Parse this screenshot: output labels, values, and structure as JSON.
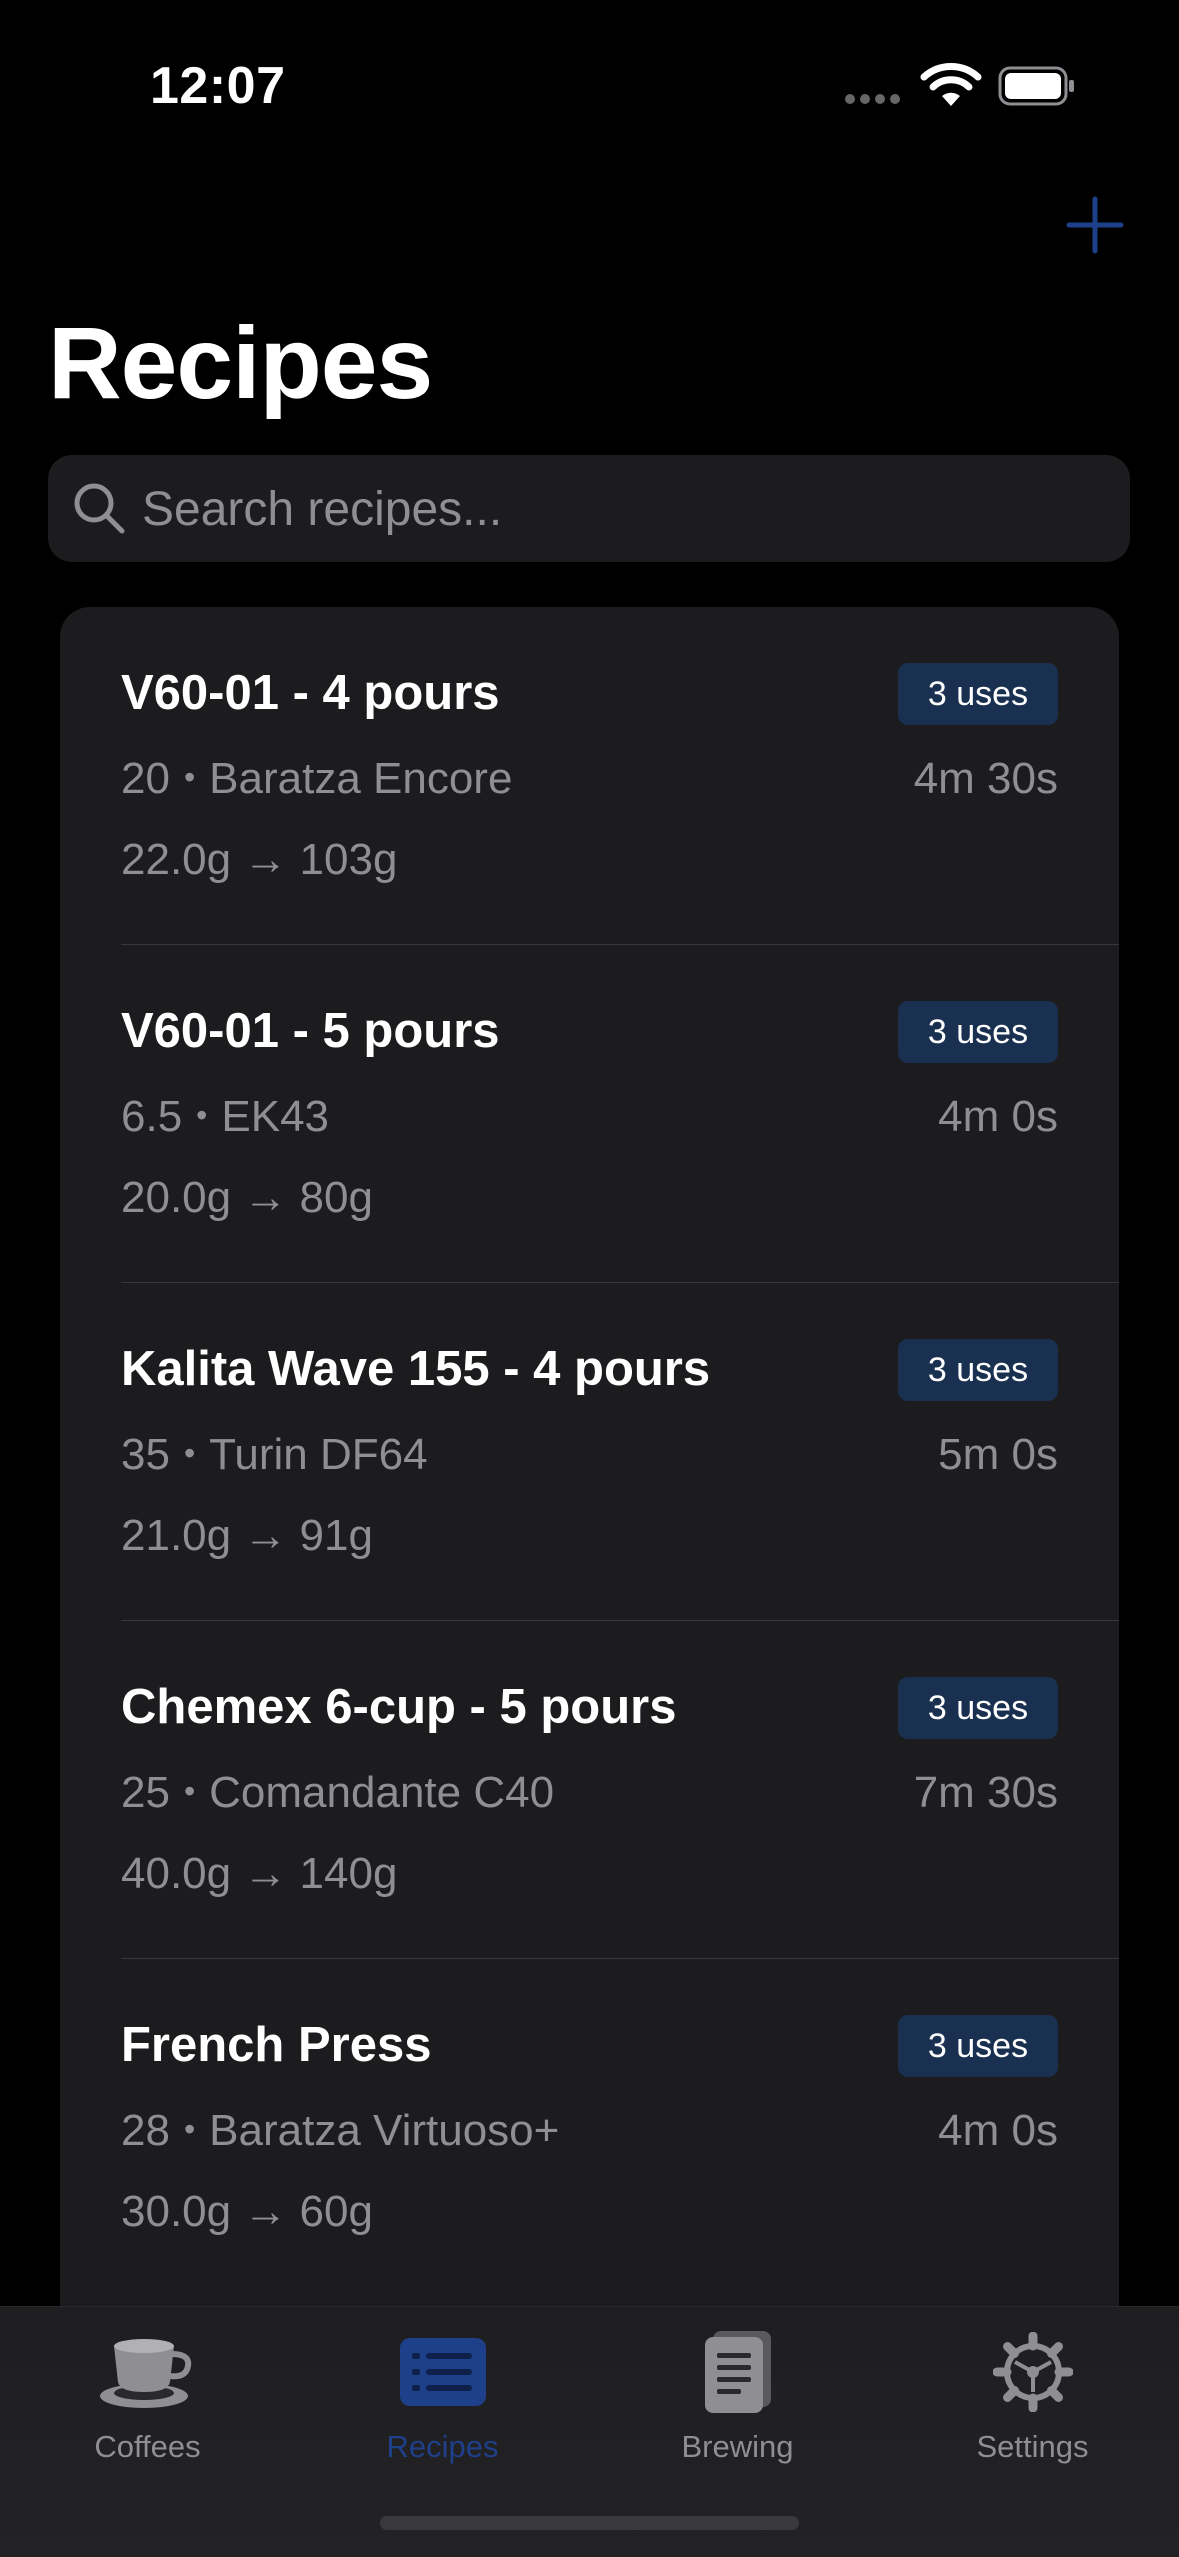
{
  "status_bar": {
    "time": "12:07"
  },
  "header": {
    "title": "Recipes",
    "add_label": "+"
  },
  "search": {
    "placeholder": "Search recipes..."
  },
  "recipes": [
    {
      "name": "V60-01 - 4 pours",
      "uses": "3 uses",
      "grind": "20",
      "grinder": "Baratza Encore",
      "separator": "•",
      "duration": "4m 30s",
      "ratio": "22.0g → 103g"
    },
    {
      "name": "V60-01 - 5 pours",
      "uses": "3 uses",
      "grind": "6.5",
      "grinder": "EK43",
      "separator": "•",
      "duration": "4m 0s",
      "ratio": "20.0g → 80g"
    },
    {
      "name": "Kalita Wave 155 - 4 pours",
      "uses": "3 uses",
      "grind": "35",
      "grinder": "Turin DF64",
      "separator": "•",
      "duration": "5m 0s",
      "ratio": "21.0g → 91g"
    },
    {
      "name": "Chemex 6-cup - 5 pours",
      "uses": "3 uses",
      "grind": "25",
      "grinder": "Comandante C40",
      "separator": "•",
      "duration": "7m 30s",
      "ratio": "40.0g → 140g"
    },
    {
      "name": "French Press",
      "uses": "3 uses",
      "grind": "28",
      "grinder": "Baratza Virtuoso+",
      "separator": "•",
      "duration": "4m 0s",
      "ratio": "30.0g → 60g"
    }
  ],
  "tab_bar": {
    "tabs": [
      {
        "label": "Coffees",
        "icon": "coffee-cup-icon",
        "active": false
      },
      {
        "label": "Recipes",
        "icon": "list-icon",
        "active": true
      },
      {
        "label": "Brewing",
        "icon": "notebook-icon",
        "active": false
      },
      {
        "label": "Settings",
        "icon": "gear-icon",
        "active": false
      }
    ]
  },
  "colors": {
    "background": "#000000",
    "surface": "#1c1c1e",
    "accent": "#1e3f8a",
    "badge": "#1a3050",
    "secondary_text": "#8e8e93"
  }
}
